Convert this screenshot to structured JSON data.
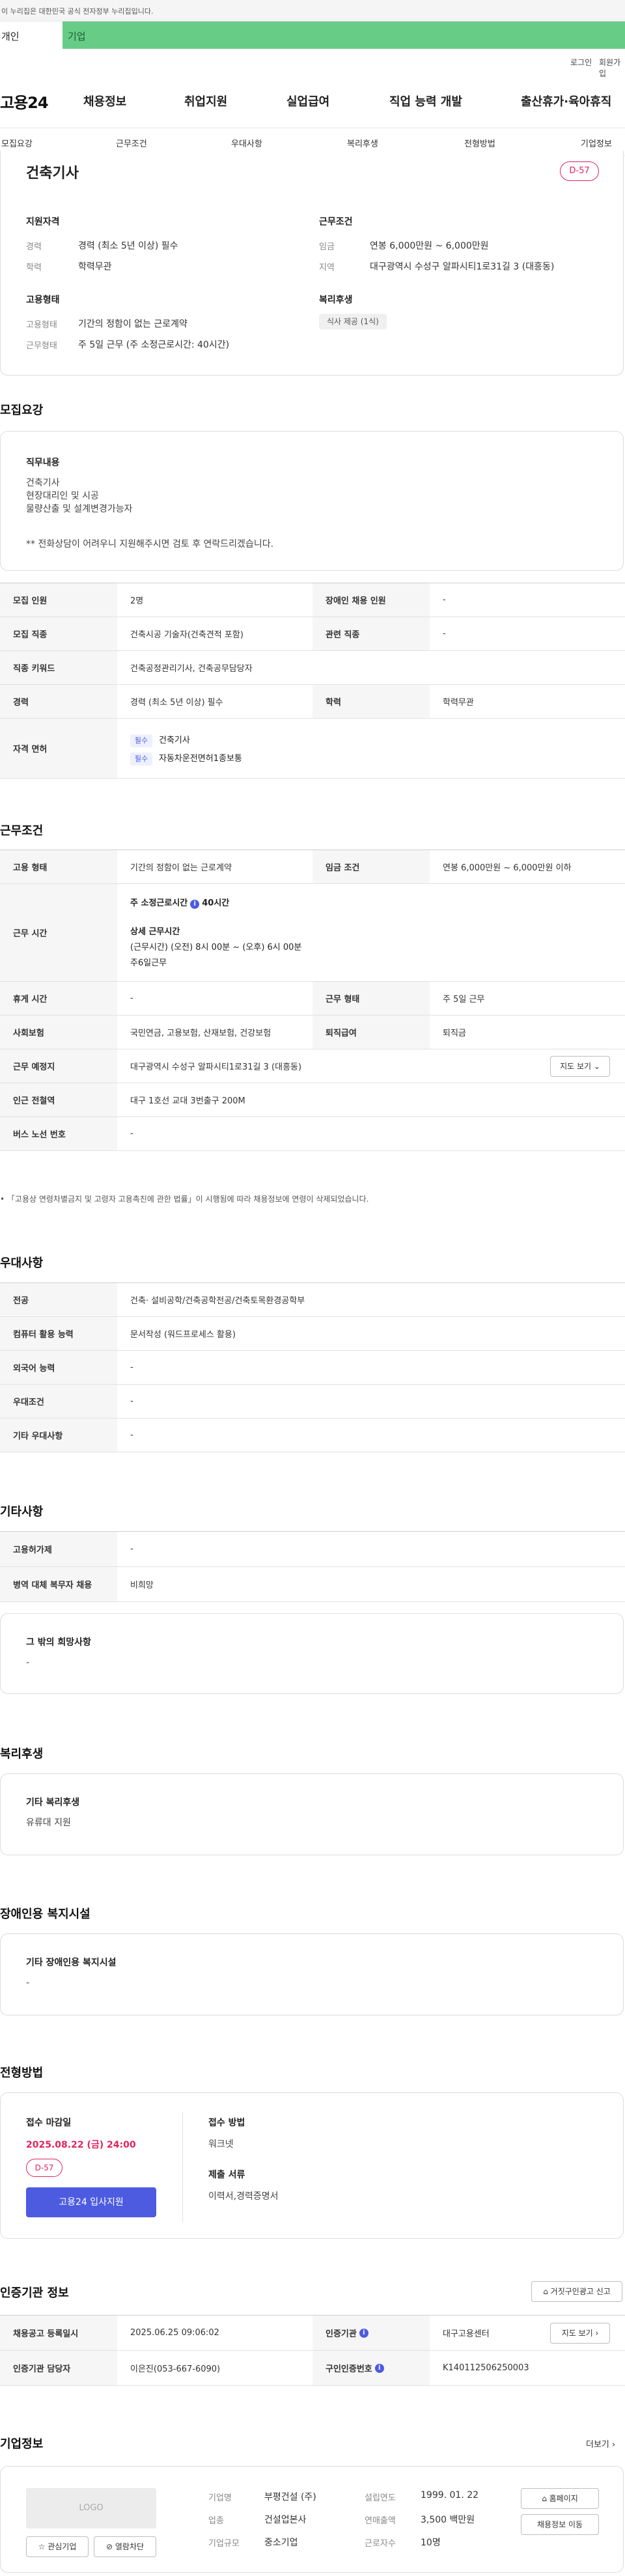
{
  "gov_banner": "이 누리집은 대한민국 공식 전자정부 누리집입니다.",
  "user_tabs": {
    "individual": "개인",
    "business": "기업"
  },
  "util": {
    "login": "로그인",
    "signup": "회원가입"
  },
  "site": {
    "logo": "고용24"
  },
  "gnb": [
    "채용정보",
    "취업지원",
    "실업급여",
    "직업 능력 개발",
    "출산휴가·육아휴직"
  ],
  "subnav": [
    "모집요강",
    "근무조건",
    "우대사항",
    "복리후생",
    "전형방법",
    "기업정보"
  ],
  "job": {
    "title": "건축기사",
    "dday": "D-57",
    "qual_heading": "지원자격",
    "qual": [
      {
        "k": "경력",
        "v": "경력 (최소 5년 이상) 필수"
      },
      {
        "k": "학력",
        "v": "학력무관"
      }
    ],
    "cond_heading": "근무조건",
    "cond": [
      {
        "k": "임금",
        "v": "연봉 6,000만원 ~ 6,000만원"
      },
      {
        "k": "지역",
        "v": "대구광역시 수성구 알파시티1로31길 3 (대흥동)"
      }
    ],
    "emp_heading": "고용형태",
    "emp": [
      {
        "k": "고용형태",
        "v": "기간의 정함이 없는 근로계약"
      },
      {
        "k": "근무형태",
        "v": "주 5일 근무 (주 소정근로시간: 40시간)"
      }
    ],
    "welfare_heading": "복리후생",
    "welfare_chip": "식사 제공 (1식)"
  },
  "recruit": {
    "title": "모집요강",
    "duty_label": "직무내용",
    "duty_lines": [
      "건축기사",
      "현장대리인 및 시공",
      "물량산출 및 설계변경가능자"
    ],
    "duty_note": "** 전화상담이 어려우니 지원해주시면 검토 후 연락드리겠습니다.",
    "rows": {
      "headcount_k": "모집 인원",
      "headcount_v": "2명",
      "disabled_k": "장애인 채용 인원",
      "disabled_v": "-",
      "occupation_k": "모집 직종",
      "occupation_v": "건축시공 기술자(건축견적 포함)",
      "related_k": "관련 직종",
      "related_v": "-",
      "keyword_k": "직종 키워드",
      "keyword_v": "건축공정관리기사, 건축공무담당자",
      "career_k": "경력",
      "career_v": "경력 (최소 5년 이상) 필수",
      "edu_k": "학력",
      "edu_v": "학력무관",
      "license_k": "자격 면허",
      "licenses": [
        {
          "tag": "필수",
          "name": "건축기사"
        },
        {
          "tag": "필수",
          "name": "자동차운전면허1종보통"
        }
      ]
    }
  },
  "work": {
    "title": "근무조건",
    "type_k": "고용 형태",
    "type_v": "기간의 정함이 없는 근로계약",
    "wage_k": "임금 조건",
    "wage_v": "연봉 6,000만원 ~ 6,000만원 이하",
    "hours_k": "근무 시간",
    "hours_main_label": "주 소정근로시간",
    "hours_main_value": "40시간",
    "hours_detail_label": "상세 근무시간",
    "hours_detail_1": "(근무시간) (오전) 8시 00분 ~ (오후) 6시 00분",
    "hours_detail_2": "주6일근무",
    "break_k": "휴게 시간",
    "break_v": "-",
    "form_k": "근무 형태",
    "form_v": "주 5일 근무",
    "insurance_k": "사회보험",
    "insurance_v": "국민연금, 고용보험, 산재보험, 건강보험",
    "severance_k": "퇴직급여",
    "severance_v": "퇴직금",
    "place_k": "근무 예정지",
    "place_v": "대구광역시 수성구 알파시티1로31길 3 (대흥동)",
    "map_btn": "지도 보기",
    "subway_k": "인근 전철역",
    "subway_v": "대구 1호선 교대 3번출구 200M",
    "bus_k": "버스 노선 번호",
    "bus_v": "-",
    "note": "「고용상 연령차별금지 및 고령자 고용촉진에 관한 법률」이 시행됨에 따라 채용정보에 연령이 삭제되었습니다."
  },
  "pref": {
    "title": "우대사항",
    "major_k": "전공",
    "major_v": "건축· 설비공학/건축공학전공/건축토목환경공학부",
    "computer_k": "컴퓨터 활용 능력",
    "computer_v": "문서작성 (워드프로세스 활용)",
    "language_k": "외국어 능력",
    "language_v": "-",
    "cond_k": "우대조건",
    "cond_v": "-",
    "etc_k": "기타 우대사항",
    "etc_v": "-"
  },
  "misc": {
    "title": "기타사항",
    "ins_k": "고용허가제",
    "ins_v": "-",
    "military_k": "병역 대체 복무자 채용",
    "military_v": "비희망",
    "hope_label": "그 밖의 희망사항",
    "hope_v": "-"
  },
  "welfare": {
    "title": "복리후생",
    "label": "기타 복리후생",
    "value": "유류대 지원"
  },
  "facility": {
    "title": "장애인용 복지시설",
    "label": "기타 장애인용 복지시설",
    "value": "-"
  },
  "process": {
    "title": "전형방법",
    "deadline_label": "접수 마감일",
    "deadline": "2025.08.22 (금) 24:00",
    "dday": "D-57",
    "apply_btn": "고용24 입사지원",
    "method_label": "접수 방법",
    "method": "워크넷",
    "docs_label": "제출 서류",
    "docs": "이력서,경력증명서"
  },
  "cert": {
    "title": "인증기관 정보",
    "report_btn": "거짓구인광고 신고",
    "reg_k": "채용공고 등록일시",
    "reg_v": "2025.06.25 09:06:02",
    "org_k": "인증기관",
    "org_v": "대구고용센터",
    "map_btn": "지도 보기",
    "manager_k": "인증기관 담당자",
    "manager_v": "이은진(053-667-6090)",
    "no_k": "구인인증번호",
    "no_v": "K140112506250003"
  },
  "company": {
    "title": "기업정보",
    "more": "더보기",
    "logo": "LOGO",
    "name_k": "기업명",
    "name_v": "부평건설 (주)",
    "industry_k": "업종",
    "industry_v": "건설업본사",
    "scale_k": "기업규모",
    "scale_v": "중소기업",
    "founded_k": "설립연도",
    "founded_v": "1999. 01. 22",
    "sales_k": "연매출액",
    "sales_v": "3,500 백만원",
    "employees_k": "근로자수",
    "employees_v": "10명",
    "homepage_btn": "홈페이지",
    "recruit_btn": "채용정보 이동",
    "fav_btn": "관심기업",
    "block_btn": "열람차단"
  }
}
